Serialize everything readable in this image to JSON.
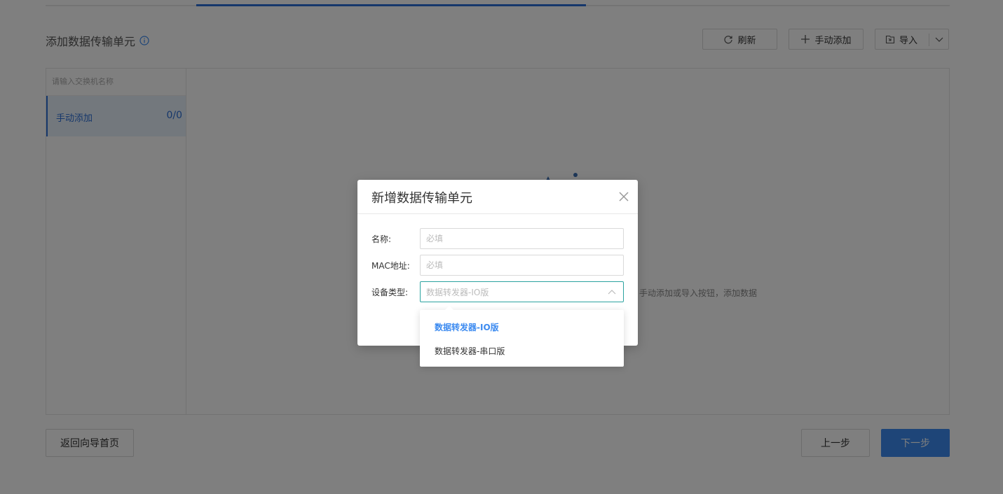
{
  "page": {
    "title": "添加数据传输单元",
    "toolbar": {
      "refresh_label": "刷新",
      "manual_add_label": "手动添加",
      "import_label": "导入"
    },
    "sidebar": {
      "search_placeholder": "请输入交换机名称",
      "items": [
        {
          "label": "手动添加",
          "count": "0/0"
        }
      ]
    },
    "empty_hint": "手动添加或导入按钮，添加数据",
    "footer": {
      "back_label": "返回向导首页",
      "prev_label": "上一步",
      "next_label": "下一步"
    }
  },
  "modal": {
    "title": "新增数据传输单元",
    "fields": {
      "name_label": "名称:",
      "name_placeholder": "必填",
      "mac_label": "MAC地址:",
      "mac_placeholder": "必填",
      "type_label": "设备类型:",
      "type_placeholder": "数据转发器-IO版"
    },
    "dropdown_options": [
      {
        "label": "数据转发器-IO版",
        "selected": true
      },
      {
        "label": "数据转发器-串口版",
        "selected": false
      }
    ]
  },
  "colors": {
    "accent": "#2c6fd6",
    "primary_button": "#3d8bf0",
    "select_focus": "#2ba3a0",
    "overlay": "rgba(0,0,0,0.5)"
  }
}
